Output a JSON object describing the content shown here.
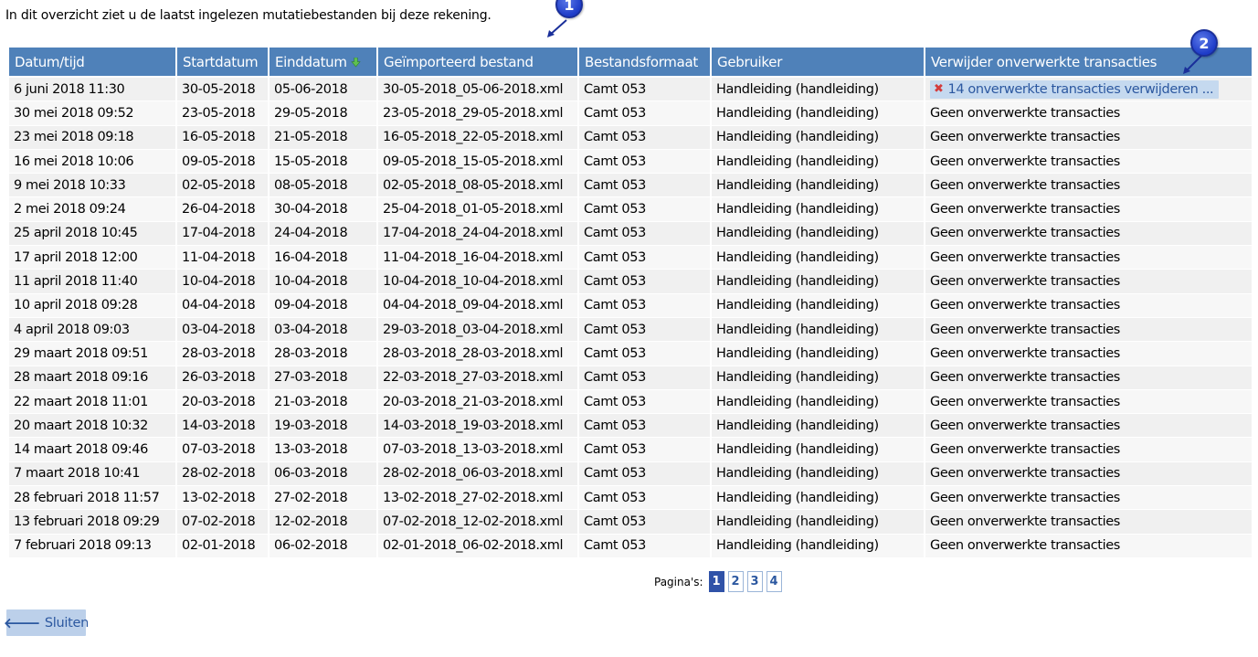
{
  "intro_text": "In dit overzicht ziet u de laatst ingelezen mutatiebestanden bij deze rekening.",
  "table": {
    "headers": [
      "Datum/tijd",
      "Startdatum",
      "Einddatum",
      "Geïmporteerd bestand",
      "Bestandsformaat",
      "Gebruiker",
      "Verwijder onverwerkte transacties"
    ],
    "sort_icon": "sort-down-arrow-icon",
    "rows": [
      [
        "6 juni 2018 11:30",
        "30-05-2018",
        "05-06-2018",
        "30-05-2018_05-06-2018.xml",
        "Camt 053",
        "Handleiding (handleiding)",
        "14 onverwerkte transacties verwijderen ..."
      ],
      [
        "30 mei 2018 09:52",
        "23-05-2018",
        "29-05-2018",
        "23-05-2018_29-05-2018.xml",
        "Camt 053",
        "Handleiding (handleiding)",
        "Geen onverwerkte transacties"
      ],
      [
        "23 mei 2018 09:18",
        "16-05-2018",
        "21-05-2018",
        "16-05-2018_22-05-2018.xml",
        "Camt 053",
        "Handleiding (handleiding)",
        "Geen onverwerkte transacties"
      ],
      [
        "16 mei 2018 10:06",
        "09-05-2018",
        "15-05-2018",
        "09-05-2018_15-05-2018.xml",
        "Camt 053",
        "Handleiding (handleiding)",
        "Geen onverwerkte transacties"
      ],
      [
        "9 mei 2018 10:33",
        "02-05-2018",
        "08-05-2018",
        "02-05-2018_08-05-2018.xml",
        "Camt 053",
        "Handleiding (handleiding)",
        "Geen onverwerkte transacties"
      ],
      [
        "2 mei 2018 09:24",
        "26-04-2018",
        "30-04-2018",
        "25-04-2018_01-05-2018.xml",
        "Camt 053",
        "Handleiding (handleiding)",
        "Geen onverwerkte transacties"
      ],
      [
        "25 april 2018 10:45",
        "17-04-2018",
        "24-04-2018",
        "17-04-2018_24-04-2018.xml",
        "Camt 053",
        "Handleiding (handleiding)",
        "Geen onverwerkte transacties"
      ],
      [
        "17 april 2018 12:00",
        "11-04-2018",
        "16-04-2018",
        "11-04-2018_16-04-2018.xml",
        "Camt 053",
        "Handleiding (handleiding)",
        "Geen onverwerkte transacties"
      ],
      [
        "11 april 2018 11:40",
        "10-04-2018",
        "10-04-2018",
        "10-04-2018_10-04-2018.xml",
        "Camt 053",
        "Handleiding (handleiding)",
        "Geen onverwerkte transacties"
      ],
      [
        "10 april 2018 09:28",
        "04-04-2018",
        "09-04-2018",
        "04-04-2018_09-04-2018.xml",
        "Camt 053",
        "Handleiding (handleiding)",
        "Geen onverwerkte transacties"
      ],
      [
        "4 april 2018 09:03",
        "03-04-2018",
        "03-04-2018",
        "29-03-2018_03-04-2018.xml",
        "Camt 053",
        "Handleiding (handleiding)",
        "Geen onverwerkte transacties"
      ],
      [
        "29 maart 2018 09:51",
        "28-03-2018",
        "28-03-2018",
        "28-03-2018_28-03-2018.xml",
        "Camt 053",
        "Handleiding (handleiding)",
        "Geen onverwerkte transacties"
      ],
      [
        "28 maart 2018 09:16",
        "26-03-2018",
        "27-03-2018",
        "22-03-2018_27-03-2018.xml",
        "Camt 053",
        "Handleiding (handleiding)",
        "Geen onverwerkte transacties"
      ],
      [
        "22 maart 2018 11:01",
        "20-03-2018",
        "21-03-2018",
        "20-03-2018_21-03-2018.xml",
        "Camt 053",
        "Handleiding (handleiding)",
        "Geen onverwerkte transacties"
      ],
      [
        "20 maart 2018 10:32",
        "14-03-2018",
        "19-03-2018",
        "14-03-2018_19-03-2018.xml",
        "Camt 053",
        "Handleiding (handleiding)",
        "Geen onverwerkte transacties"
      ],
      [
        "14 maart 2018 09:46",
        "07-03-2018",
        "13-03-2018",
        "07-03-2018_13-03-2018.xml",
        "Camt 053",
        "Handleiding (handleiding)",
        "Geen onverwerkte transacties"
      ],
      [
        "7 maart 2018 10:41",
        "28-02-2018",
        "06-03-2018",
        "28-02-2018_06-03-2018.xml",
        "Camt 053",
        "Handleiding (handleiding)",
        "Geen onverwerkte transacties"
      ],
      [
        "28 februari 2018 11:57",
        "13-02-2018",
        "27-02-2018",
        "13-02-2018_27-02-2018.xml",
        "Camt 053",
        "Handleiding (handleiding)",
        "Geen onverwerkte transacties"
      ],
      [
        "13 februari 2018 09:29",
        "07-02-2018",
        "12-02-2018",
        "07-02-2018_12-02-2018.xml",
        "Camt 053",
        "Handleiding (handleiding)",
        "Geen onverwerkte transacties"
      ],
      [
        "7 februari 2018 09:13",
        "02-01-2018",
        "06-02-2018",
        "02-01-2018_06-02-2018.xml",
        "Camt 053",
        "Handleiding (handleiding)",
        "Geen onverwerkte transacties"
      ]
    ]
  },
  "pager": {
    "label": "Pagina's:",
    "pages": [
      "1",
      "2",
      "3",
      "4"
    ],
    "current": "1"
  },
  "close_button": {
    "label": "Sluiten",
    "icon": "arrow-left-icon"
  },
  "callouts": [
    "1",
    "2"
  ],
  "colors": {
    "header_bg": "#4f81b9",
    "accent": "#2c58a0",
    "delete_icon": "#d43c3c",
    "callout": "#1e3cc8"
  }
}
